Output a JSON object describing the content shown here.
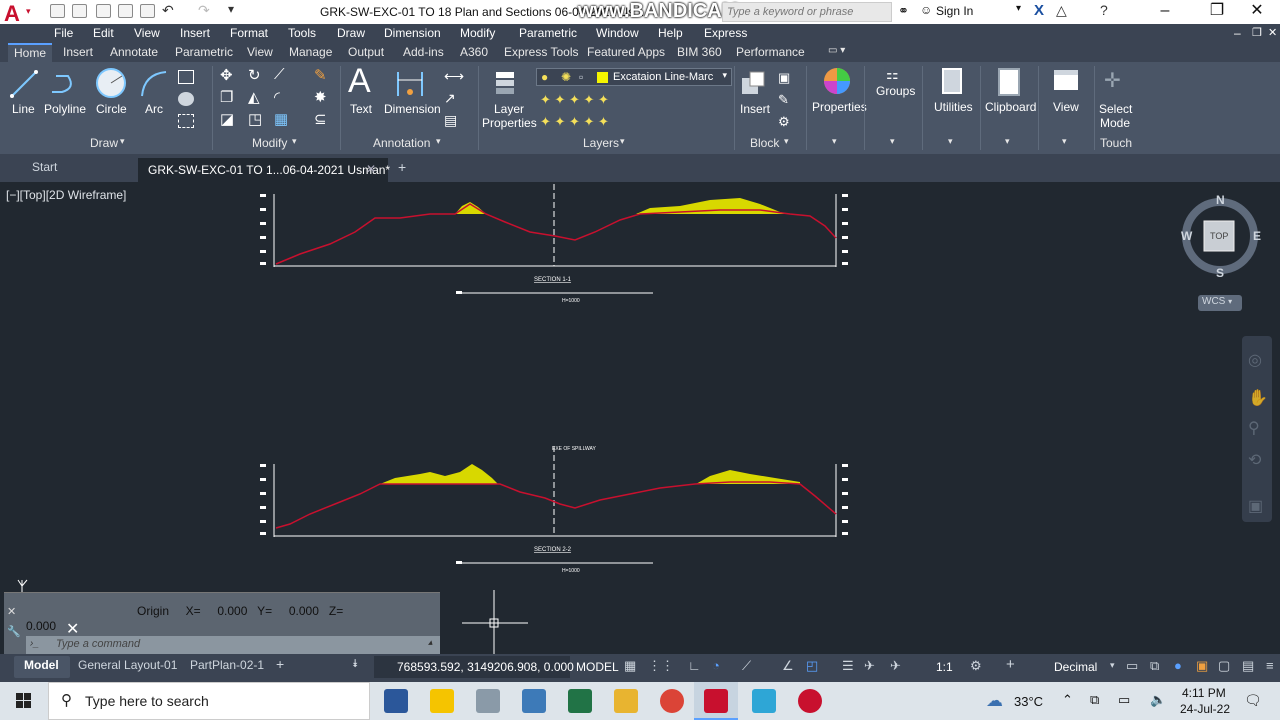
{
  "app": {
    "logo_letter": "A",
    "title": "GRK-SW-EXC-01 TO 18  Plan and Sections 06-04-2021 Us...",
    "watermark": "www.BANDICAM.com",
    "search_placeholder": "Type a keyword or phrase",
    "sign_in": "Sign In"
  },
  "menu": [
    "File",
    "Edit",
    "View",
    "Insert",
    "Format",
    "Tools",
    "Draw",
    "Dimension",
    "Modify",
    "Parametric",
    "Window",
    "Help",
    "Express"
  ],
  "ribbon_tabs": [
    "Home",
    "Insert",
    "Annotate",
    "Parametric",
    "View",
    "Manage",
    "Output",
    "Add-ins",
    "A360",
    "Express Tools",
    "Featured Apps",
    "BIM 360",
    "Performance"
  ],
  "ribbon": {
    "draw": {
      "title": "Draw",
      "tools": [
        "Line",
        "Polyline",
        "Circle",
        "Arc"
      ]
    },
    "modify": {
      "title": "Modify"
    },
    "annotation": {
      "title": "Annotation",
      "text": "Text",
      "dimension": "Dimension"
    },
    "layers": {
      "title": "Layers",
      "layer_properties_1": "Layer",
      "layer_properties_2": "Properties",
      "current_layer": "Excataion Line-Marc"
    },
    "block": {
      "title": "Block",
      "insert": "Insert"
    },
    "properties": "Properties",
    "groups": "Groups",
    "utilities": "Utilities",
    "clipboard": "Clipboard",
    "view": "View",
    "touch": {
      "select_1": "Select",
      "select_2": "Mode",
      "title": "Touch"
    }
  },
  "file_tabs": {
    "start": "Start",
    "active": "GRK-SW-EXC-01 TO 1...06-04-2021 Usman*"
  },
  "viewport_label": "[−][Top][2D Wireframe]",
  "drawing": {
    "section1_title": "SECTION 1-1",
    "section2_title": "SECTION 2-2",
    "spillway_label": "EXE OF SPILLWAY",
    "scale_label": "H=1000"
  },
  "viewcube": {
    "n": "N",
    "s": "S",
    "e": "E",
    "w": "W",
    "top": "TOP",
    "wcs": "WCS"
  },
  "command": {
    "origin_line": "Origin     X=     0.000   Y=     0.000   Z=",
    "value_line": "0.000",
    "placeholder": "Type a command"
  },
  "layout_tabs": [
    "Model",
    "General Layout-01",
    "PartPlan-02-1"
  ],
  "status": {
    "coords": "768593.592, 3149206.908, 0.000",
    "mode": "MODEL",
    "scale": "1:1",
    "units": "Decimal"
  },
  "taskbar": {
    "search": "Type here to search",
    "temp": "33°C",
    "time": "4:11 PM",
    "date": "24-Jul-22"
  },
  "colors": {
    "terrain": "#c8102e",
    "fill": "#d8d800",
    "accent": "#5aa0ff"
  }
}
